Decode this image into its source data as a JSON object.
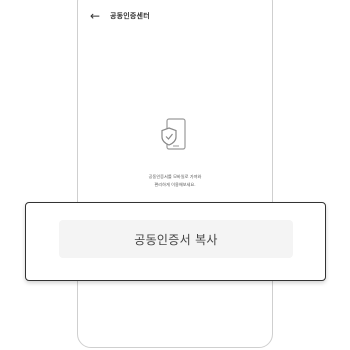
{
  "header": {
    "back_icon": "arrow-left-icon",
    "title": "공동인증센터"
  },
  "main": {
    "icon": "phone-shield-check-icon",
    "description_line1": "공동인증서를 모바일로 가져와",
    "description_line2": "편리하게 이용해보세요."
  },
  "popup": {
    "copy_button_label": "공동인증서 복사"
  },
  "colors": {
    "border": "#cfcfcf",
    "card_border": "#333333",
    "button_bg": "#f4f4f4",
    "text": "#444444"
  }
}
